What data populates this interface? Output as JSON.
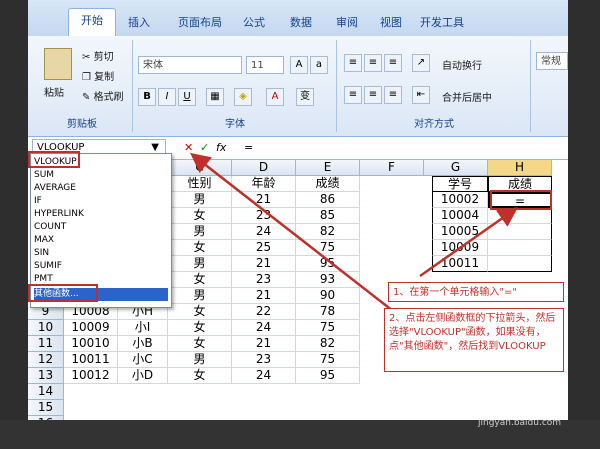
{
  "ribbon": {
    "tabs": [
      "开始",
      "插入",
      "页面布局",
      "公式",
      "数据",
      "审阅",
      "视图",
      "开发工具"
    ],
    "clipboard": {
      "paste": "粘贴",
      "cut": "剪切",
      "copy": "复制",
      "format_painter": "格式刷",
      "label": "剪贴板"
    },
    "font": {
      "name": "宋体",
      "size": "11",
      "label": "字体"
    },
    "align": {
      "wrap": "自动换行",
      "merge": "合并后居中",
      "label": "对齐方式"
    },
    "number": {
      "format": "常规"
    }
  },
  "formula_bar": {
    "name_box": "VLOOKUP",
    "fx": "fx",
    "content": "="
  },
  "dropdown": {
    "items": [
      "VLOOKUP",
      "SUM",
      "AVERAGE",
      "IF",
      "HYPERLINK",
      "COUNT",
      "MAX",
      "SIN",
      "SUMIF",
      "PMT",
      "其他函数..."
    ]
  },
  "grid": {
    "col_headers": [
      "C",
      "D",
      "E",
      "F",
      "G",
      "H"
    ],
    "header_row": {
      "C": "性别",
      "D": "年龄",
      "E": "成绩",
      "G": "学号",
      "H": "成绩"
    },
    "upper_rows": [
      {
        "C": "男",
        "D": "21",
        "E": "86",
        "G": "10002",
        "H": "="
      },
      {
        "C": "女",
        "D": "23",
        "E": "85",
        "G": "10004",
        "H": ""
      },
      {
        "C": "男",
        "D": "24",
        "E": "82",
        "G": "10005",
        "H": ""
      },
      {
        "C": "女",
        "D": "25",
        "E": "75",
        "G": "10009",
        "H": ""
      },
      {
        "C": "男",
        "D": "21",
        "E": "95",
        "G": "10011",
        "H": ""
      },
      {
        "C": "女",
        "D": "23",
        "E": "93",
        "G": "",
        "H": ""
      },
      {
        "C": "男",
        "D": "21",
        "E": "90",
        "G": "",
        "H": ""
      },
      {
        "C": "女",
        "D": "22",
        "E": "78",
        "G": "",
        "H": ""
      }
    ],
    "lower_rows": [
      {
        "row": "9",
        "A": "10008",
        "B": "小H",
        "C": "女",
        "D": "23",
        "E": "82"
      },
      {
        "row": "10",
        "A": "10009",
        "B": "小I",
        "C": "女",
        "D": "24",
        "E": "75"
      },
      {
        "row": "11",
        "A": "10010",
        "B": "小B",
        "C": "女",
        "D": "21",
        "E": "82"
      },
      {
        "row": "12",
        "A": "10011",
        "B": "小C",
        "C": "男",
        "D": "23",
        "E": "75"
      },
      {
        "row": "13",
        "A": "10012",
        "B": "小D",
        "C": "女",
        "D": "24",
        "E": "95"
      },
      {
        "row": "14"
      },
      {
        "row": "15"
      },
      {
        "row": "16"
      }
    ]
  },
  "annotations": {
    "step1": "1、在第一个单元格输入\"=\"",
    "step2": "2、点击左侧函数框的下拉箭头，然后选择\"VLOOKUP\"函数，如果没有，点\"其他函数\"，然后找到VLOOKUP"
  },
  "watermark": {
    "brand": "Bai",
    "sub": "jingyan.baidu.com"
  },
  "colors": {
    "annotation_red": "#c0302a",
    "selection_blue": "#2a63c9"
  }
}
